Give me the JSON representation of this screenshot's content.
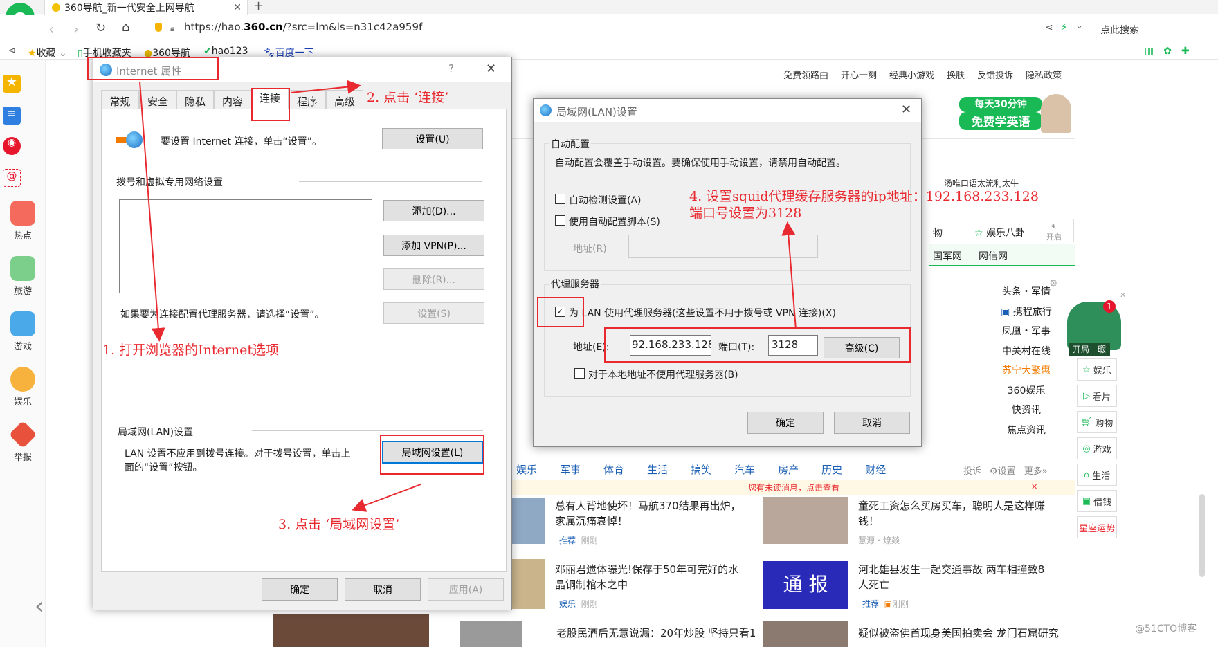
{
  "browser": {
    "tab_title": "360导航_新一代安全上网导航",
    "url_prefix": "https://hao.",
    "url_domain": "360.cn",
    "url_suffix": "/?src=lm&ls=n31c42a959f",
    "search_label": "点此搜索",
    "bookmarks": [
      "收藏",
      "手机收藏夹",
      "360导航",
      "hao123",
      "百度一下"
    ]
  },
  "left_sidebar": [
    "热点",
    "旅游",
    "游戏",
    "娱乐",
    "举报"
  ],
  "page": {
    "top_links": [
      "免费领路由",
      "开心一刻",
      "经典小游戏",
      "换肤",
      "反馈投诉",
      "隐私政策"
    ],
    "ad_banner_top": "每天30分钟",
    "ad_banner_bottom": "免费学英语",
    "promo_text": "汤唯口语太流利太牛",
    "side_entries": [
      "物",
      "娱乐八卦",
      "开启",
      "国军网",
      "网信网"
    ],
    "list_right": [
      "头条・军情",
      "携程旅行",
      "凤凰・军事",
      "中关村在线",
      "苏宁大聚惠",
      "360娱乐",
      "快资讯",
      "焦点资讯"
    ],
    "right_sidebar": [
      "娱乐",
      "看片",
      "购物",
      "游戏",
      "生活",
      "借钱",
      "星座运势"
    ],
    "float_badge": "开局一暇",
    "float_count": "1",
    "news_tabs": [
      "娱乐",
      "军事",
      "体育",
      "生活",
      "搞笑",
      "汽车",
      "房产",
      "历史",
      "财经"
    ],
    "news_tools": [
      "投诉",
      "设置",
      "更多»"
    ],
    "unread_notice": "您有未读消息，点击查看",
    "news": [
      {
        "title": "总有人背地使坏！马航370结果再出炉，家属沉痛哀悼！",
        "tag": "推荐",
        "time": "刚刚"
      },
      {
        "title": "童死工资怎么买房买车，聪明人是这样赚钱！",
        "tag": "慧源・燎燚",
        "time": ""
      },
      {
        "title": "邓丽君遗体曝光!保存于50年可完好的水晶铜制棺木之中",
        "tag": "娱乐",
        "time": "刚刚"
      },
      {
        "title": "河北雄县发生一起交通事故 两车相撞致8人死亡",
        "tag": "推荐",
        "time": "刚刚"
      },
      {
        "title": "老股民酒后无意说漏：20年炒股 坚持只看1",
        "tag": "",
        "time": ""
      },
      {
        "title": "疑似被盗佛首现身美国拍卖会 龙门石窟研究",
        "tag": "",
        "time": ""
      }
    ],
    "tongbao": "通 报",
    "watermark": "@51CTO博客"
  },
  "inet_dialog": {
    "title": "Internet 属性",
    "help": "?",
    "tabs": [
      "常规",
      "安全",
      "隐私",
      "内容",
      "连接",
      "程序",
      "高级"
    ],
    "setup_text": "要设置 Internet 连接，单击“设置”。",
    "setup_btn": "设置(U)",
    "dialup_group": "拨号和虚拟专用网络设置",
    "add_btn": "添加(D)...",
    "add_vpn_btn": "添加 VPN(P)...",
    "delete_btn": "删除(R)...",
    "settings_btn": "设置(S)",
    "proxy_hint": "如果要为连接配置代理服务器，请选择“设置”。",
    "lan_group": "局域网(LAN)设置",
    "lan_text_1": "LAN 设置不应用到拨号连接。对于拨号设置，单击上",
    "lan_text_2": "面的“设置”按钮。",
    "lan_btn": "局域网设置(L)",
    "ok": "确定",
    "cancel": "取消",
    "apply": "应用(A)"
  },
  "lan_dialog": {
    "title": "局域网(LAN)设置",
    "auto_group": "自动配置",
    "auto_desc": "自动配置会覆盖手动设置。要确保使用手动设置，请禁用自动配置。",
    "auto_detect": "自动检测设置(A)",
    "auto_script": "使用自动配置脚本(S)",
    "addr_r": "地址(R)",
    "proxy_group": "代理服务器",
    "proxy_check_prefix": "为",
    "proxy_check_text": "LAN 使用代理服务器(这些设置不用于拨号或 VPN 连接)(X)",
    "addr_label": "地址(E):",
    "addr_value": "92.168.233.128",
    "port_label": "端口(T):",
    "port_value": "3128",
    "advanced_btn": "高级(C)",
    "bypass_local": "对于本地地址不使用代理服务器(B)",
    "ok": "确定",
    "cancel": "取消"
  },
  "annotations": {
    "step1": "1. 打开浏览器的Internet选项",
    "step2": "2. 点击 ‘连接’",
    "step3": "3. 点击 ‘局域网设置’",
    "step4_line1": "4. 设置squid代理缓存服务器的ip地址：192.168.233.128",
    "step4_line2": "端口号设置为3128"
  },
  "colors": {
    "annotation": "#e8292f",
    "brand_green": "#19b955",
    "link_blue": "#1a5fb4"
  }
}
